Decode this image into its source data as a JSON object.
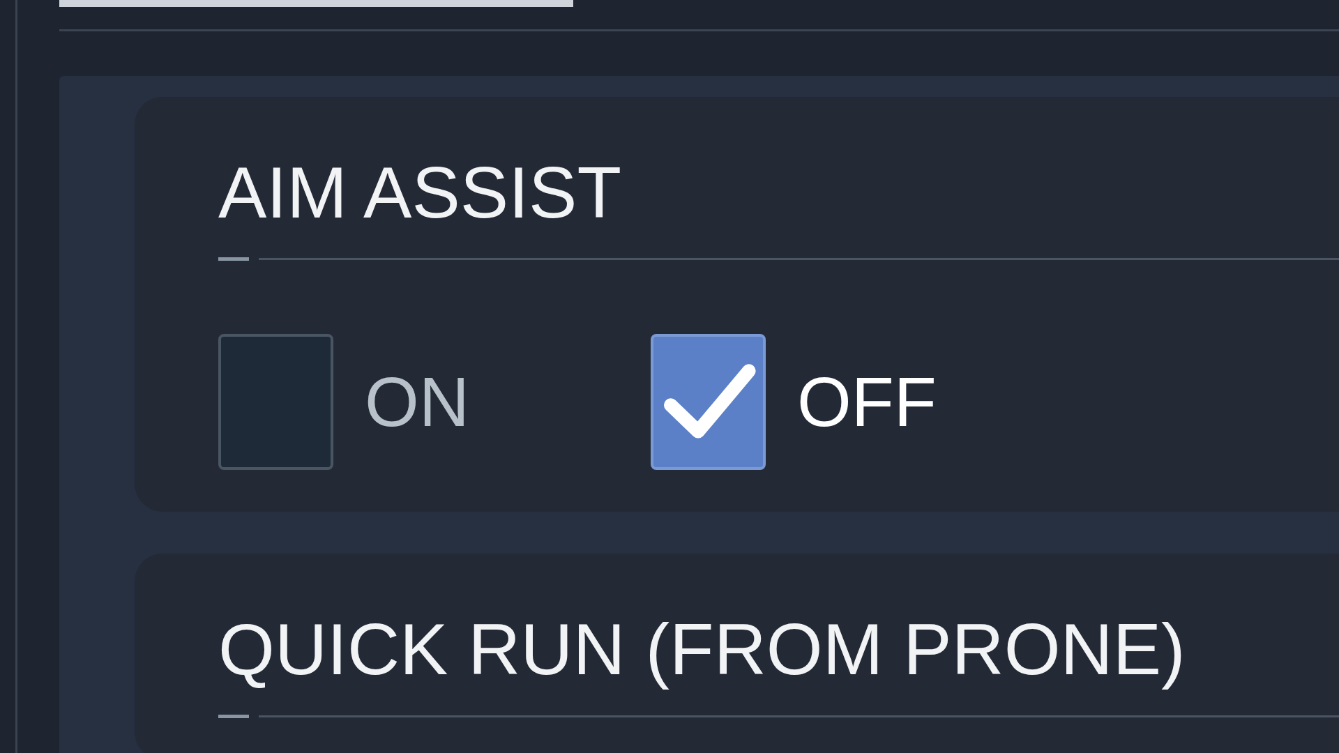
{
  "sections": [
    {
      "title": "AIM ASSIST",
      "options": [
        {
          "label": "ON",
          "selected": false
        },
        {
          "label": "OFF",
          "selected": true
        }
      ]
    },
    {
      "title": "QUICK RUN (FROM PRONE)"
    }
  ]
}
